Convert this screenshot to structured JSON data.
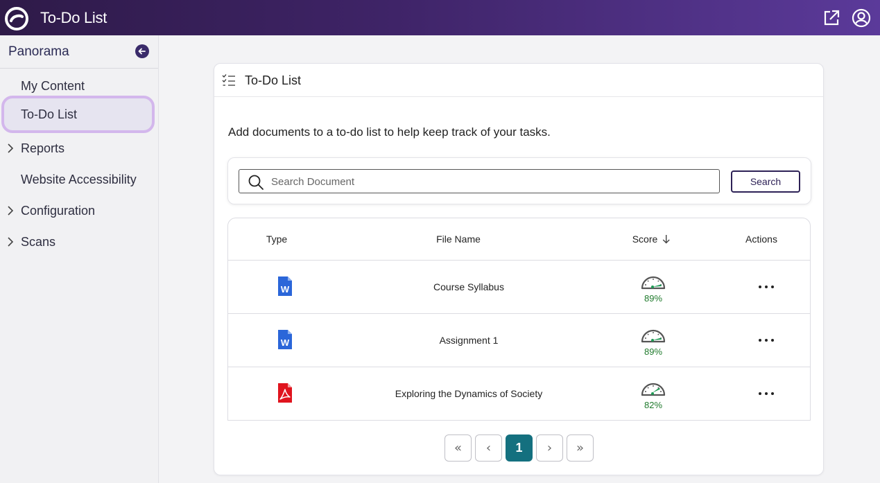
{
  "header": {
    "app_title": "To-Do List",
    "icons": [
      "logo-icon",
      "external-link-icon",
      "user-account-icon"
    ]
  },
  "sidebar": {
    "title": "Panorama",
    "items": [
      {
        "label": "My Content",
        "expandable": false
      },
      {
        "label": "To-Do List",
        "expandable": false,
        "active": true
      },
      {
        "label": "Reports",
        "expandable": true
      },
      {
        "label": "Website Accessibility",
        "expandable": false
      },
      {
        "label": "Configuration",
        "expandable": true
      },
      {
        "label": "Scans",
        "expandable": true
      }
    ]
  },
  "card": {
    "title": "To-Do List",
    "description": "Add documents to a to-do list to help keep track of your tasks.",
    "search": {
      "placeholder": "Search Document",
      "value": "",
      "button_label": "Search"
    },
    "table": {
      "columns": [
        "Type",
        "File Name",
        "Score",
        "Actions"
      ],
      "sort_column": "Score",
      "rows": [
        {
          "type": "word",
          "file_name": "Course Syllabus",
          "score": "89%",
          "score_value": 89
        },
        {
          "type": "word",
          "file_name": "Assignment 1",
          "score": "89%",
          "score_value": 89
        },
        {
          "type": "pdf",
          "file_name": "Exploring the Dynamics of Society",
          "score": "82%",
          "score_value": 82
        }
      ]
    },
    "pagination": {
      "first": "«",
      "prev": "‹",
      "current": "1",
      "next": "›",
      "last": "»"
    }
  },
  "colors": {
    "topbar_start": "#2e1a48",
    "topbar_end": "#5b3a9a",
    "active_highlight": "#d3b7ec",
    "score_green": "#1f7a2c",
    "gauge_needle": "#1f9a55",
    "word_blue": "#2b66d9",
    "pdf_red": "#e0141e",
    "page_active": "#14707f"
  }
}
